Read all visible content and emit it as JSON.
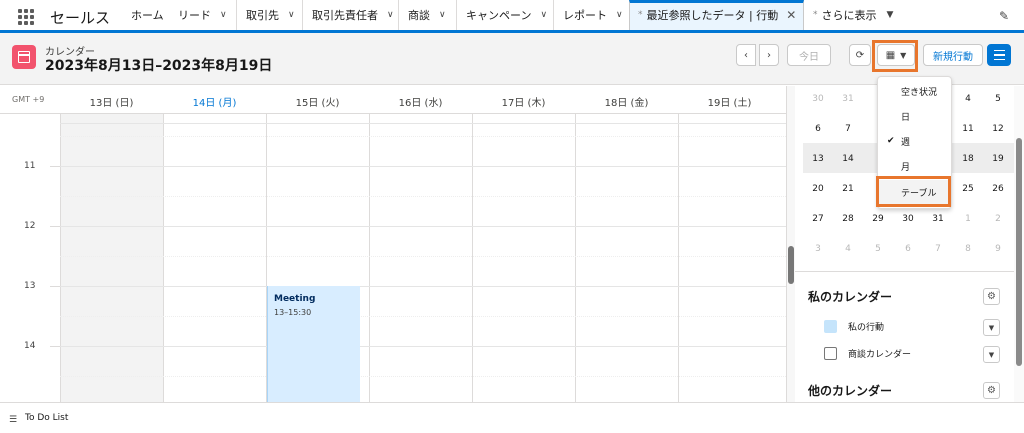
{
  "app": {
    "name": "セールス"
  },
  "nav": {
    "items": [
      "ホーム",
      "リード",
      "取引先",
      "取引先責任者",
      "商談",
      "キャンペーン",
      "レポート"
    ],
    "active_tab": "最近参照したデータ | 行動",
    "more": "さらに表示"
  },
  "header": {
    "subtitle": "カレンダー",
    "title": "2023年8月13日–2023年8月19日",
    "today_label": "今日",
    "new_event_label": "新規行動"
  },
  "grid": {
    "timezone": "GMT +9",
    "days": [
      "13日 (日)",
      "14日 (月)",
      "15日 (火)",
      "16日 (水)",
      "17日 (木)",
      "18日 (金)",
      "19日 (土)"
    ],
    "today_index": 1,
    "hours": [
      "11",
      "12",
      "13",
      "14"
    ]
  },
  "event": {
    "title": "Meeting",
    "time": "13–15:30"
  },
  "view_menu": {
    "items": [
      "空き状況",
      "日",
      "週",
      "月",
      "テーブル"
    ],
    "checked_index": 2,
    "highlighted_index": 4
  },
  "mini_calendar": {
    "rows": [
      [
        "30",
        "31",
        "",
        "",
        "",
        "4",
        "5"
      ],
      [
        "6",
        "7",
        "",
        "",
        "",
        "11",
        "12"
      ],
      [
        "13",
        "14",
        "",
        "",
        "",
        "18",
        "19"
      ],
      [
        "20",
        "21",
        "",
        "",
        "",
        "25",
        "26"
      ],
      [
        "27",
        "28",
        "29",
        "30",
        "31",
        "1",
        "2"
      ],
      [
        "3",
        "4",
        "5",
        "6",
        "7",
        "8",
        "9"
      ]
    ]
  },
  "my_calendars": {
    "title": "私のカレンダー",
    "items": [
      {
        "label": "私の行動",
        "color": "#c5e4fb"
      },
      {
        "label": "商談カレンダー",
        "color": "#ffffff"
      }
    ]
  },
  "other_calendars": {
    "title": "他のカレンダー"
  },
  "footer": {
    "label": "To Do List"
  },
  "colors": {
    "accent": "#0176d3",
    "highlight": "#e8762d",
    "event_bg": "#d8edff",
    "calendar_icon": "#f2536d"
  }
}
